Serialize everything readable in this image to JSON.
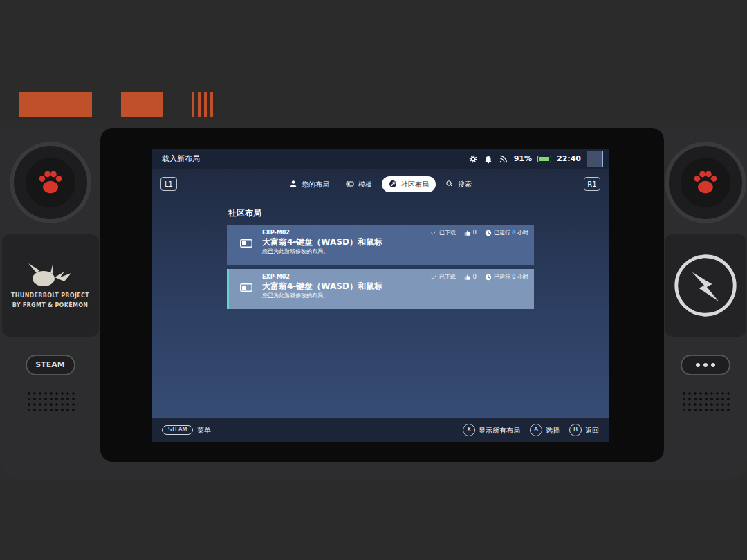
{
  "screen": {
    "title": "载入新布局",
    "status": {
      "battery": "91%",
      "battery_level": 0.91,
      "time": "22:40"
    }
  },
  "bumpers": {
    "left": "L1",
    "right": "R1"
  },
  "tabs": [
    {
      "label": "您的布局",
      "selected": false,
      "kind": "person"
    },
    {
      "label": "模板",
      "selected": false,
      "kind": "template"
    },
    {
      "label": "社区布局",
      "selected": true,
      "kind": "steam"
    },
    {
      "label": "搜索",
      "selected": false,
      "kind": "search"
    }
  ],
  "section": {
    "title": "社区布局"
  },
  "layouts": [
    {
      "game": "EXP-M02",
      "title": "大富翁4-键盘（WASD）和鼠标",
      "note": "您已为此游戏修改的布局。",
      "downloaded": "已下载",
      "likes": "0",
      "runtime": "已运行 8 小时",
      "selected": false
    },
    {
      "game": "EXP-M02",
      "title": "大富翁4-键盘（WASD）和鼠标",
      "note": "您已为此游戏修改的布局。",
      "downloaded": "已下载",
      "likes": "0",
      "runtime": "已运行 0 小时",
      "selected": true
    }
  ],
  "footer": {
    "menu_key": "STEAM",
    "menu_label": "菜单",
    "actions": [
      {
        "key": "X",
        "label": "显示所有布局"
      },
      {
        "key": "A",
        "label": "选择"
      },
      {
        "key": "B",
        "label": "返回"
      }
    ]
  },
  "device": {
    "sticker": [
      "THUNDERBOLT PROJECT",
      "BY FRGMT & POKÉMON"
    ],
    "steam_button": "STEAM"
  }
}
